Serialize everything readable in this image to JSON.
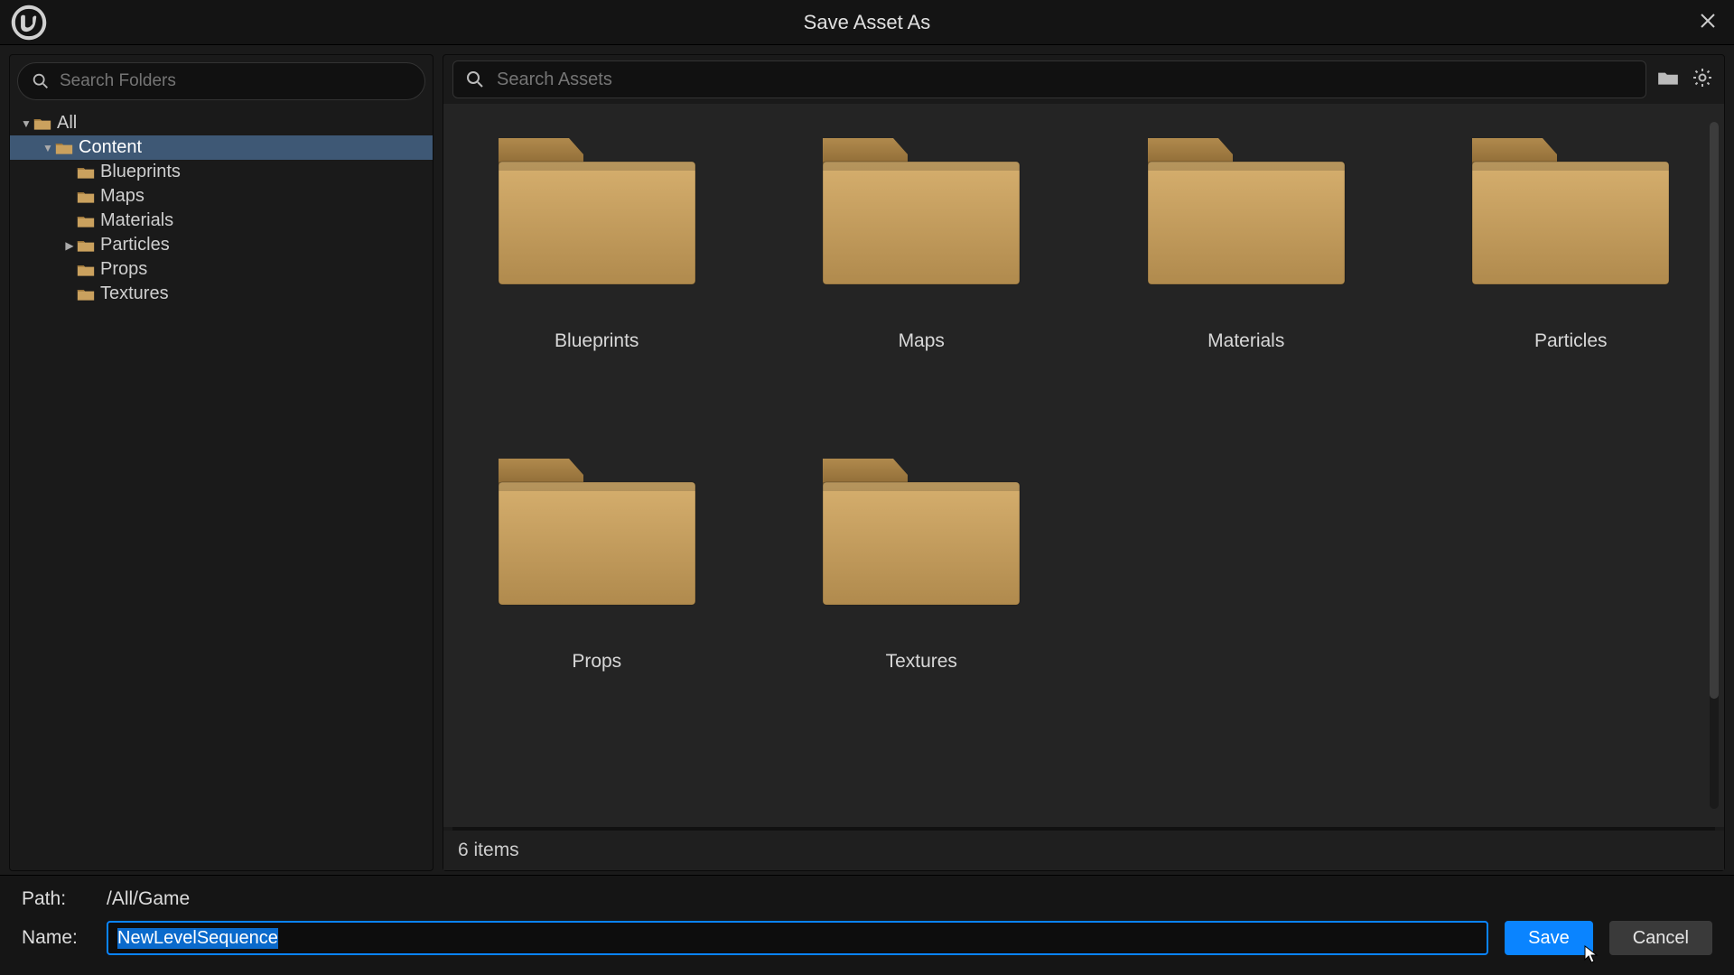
{
  "window": {
    "title": "Save Asset As"
  },
  "sidebar": {
    "search_placeholder": "Search Folders",
    "tree": [
      {
        "label": "All",
        "depth": 0,
        "expanded": true,
        "hasChildren": true,
        "selected": false
      },
      {
        "label": "Content",
        "depth": 1,
        "expanded": true,
        "hasChildren": true,
        "selected": true
      },
      {
        "label": "Blueprints",
        "depth": 2,
        "expanded": false,
        "hasChildren": false,
        "selected": false
      },
      {
        "label": "Maps",
        "depth": 2,
        "expanded": false,
        "hasChildren": false,
        "selected": false
      },
      {
        "label": "Materials",
        "depth": 2,
        "expanded": false,
        "hasChildren": false,
        "selected": false
      },
      {
        "label": "Particles",
        "depth": 2,
        "expanded": false,
        "hasChildren": true,
        "selected": false
      },
      {
        "label": "Props",
        "depth": 2,
        "expanded": false,
        "hasChildren": false,
        "selected": false
      },
      {
        "label": "Textures",
        "depth": 2,
        "expanded": false,
        "hasChildren": false,
        "selected": false
      }
    ]
  },
  "main": {
    "search_placeholder": "Search Assets",
    "folders": [
      {
        "name": "Blueprints"
      },
      {
        "name": "Maps"
      },
      {
        "name": "Materials"
      },
      {
        "name": "Particles"
      },
      {
        "name": "Props"
      },
      {
        "name": "Textures"
      }
    ],
    "status_text": "6 items"
  },
  "footer": {
    "path_label": "Path:",
    "path_value": "/All/Game",
    "name_label": "Name:",
    "name_value": "NewLevelSequence",
    "save_label": "Save",
    "cancel_label": "Cancel"
  },
  "icons": {
    "logo": "unreal-logo",
    "search": "search-icon",
    "close": "close-icon",
    "display_mode": "folder-display-icon",
    "settings": "gear-icon"
  },
  "colors": {
    "folder_light": "#c9a25f",
    "folder_dark": "#9a7438",
    "accent": "#0a84ff",
    "selection": "#3e5875"
  }
}
